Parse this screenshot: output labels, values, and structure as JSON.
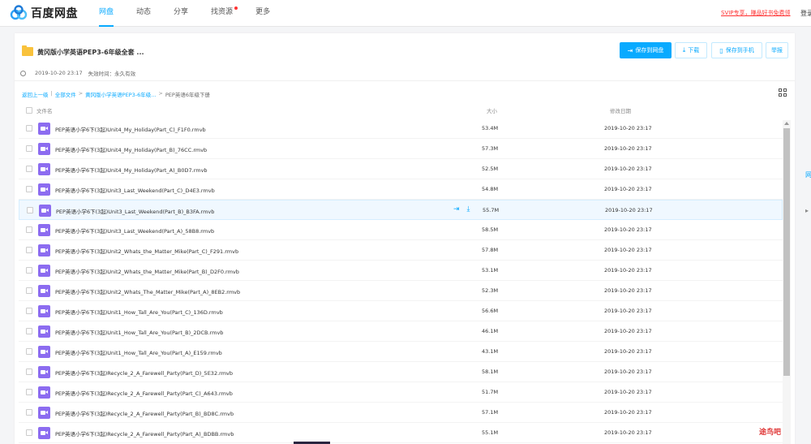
{
  "app": {
    "logo_text": "百度网盘",
    "nav": [
      {
        "label": "网盘",
        "active": true
      },
      {
        "label": "动态",
        "active": false
      },
      {
        "label": "分享",
        "active": false
      },
      {
        "label": "找资源",
        "active": false,
        "dot": true
      },
      {
        "label": "更多",
        "active": false
      }
    ],
    "promo": "SVIP专享，赚品好书免费领",
    "login": "登录"
  },
  "share": {
    "title": "黄冈版小学英语PEP3-6年级全套 ...",
    "created": "2019-10-20 23:17",
    "expiry": "失效时间：永久有效",
    "buttons": {
      "save": "保存到网盘",
      "download": "下载",
      "save_phone": "保存到手机",
      "report": "举报"
    }
  },
  "breadcrumb": {
    "back": "返回上一级",
    "all": "全部文件",
    "parent": "黄冈版小学英语PEP3-6年级...",
    "current": "PEP英语6年级下册"
  },
  "table": {
    "headers": {
      "name": "文件名",
      "size": "大小",
      "date": "修改日期"
    },
    "rows": [
      {
        "name": "PEP英语小学6下(3起)Unit4_My_Holiday(Part_C)_F1F0.rmvb",
        "size": "53.4M",
        "date": "2019-10-20 23:17"
      },
      {
        "name": "PEP英语小学6下(3起)Unit4_My_Holiday(Part_B)_76CC.rmvb",
        "size": "57.3M",
        "date": "2019-10-20 23:17"
      },
      {
        "name": "PEP英语小学6下(3起)Unit4_My_Holiday(Part_A)_B0D7.rmvb",
        "size": "52.5M",
        "date": "2019-10-20 23:17"
      },
      {
        "name": "PEP英语小学6下(3起)Unit3_Last_Weekend(Part_C)_D4E3.rmvb",
        "size": "54.8M",
        "date": "2019-10-20 23:17"
      },
      {
        "name": "PEP英语小学6下(3起)Unit3_Last_Weekend(Part_B)_B3FA.rmvb",
        "size": "55.7M",
        "date": "2019-10-20 23:17",
        "hover": true
      },
      {
        "name": "PEP英语小学6下(3起)Unit3_Last_Weekend(Part_A)_58B8.rmvb",
        "size": "58.5M",
        "date": "2019-10-20 23:17"
      },
      {
        "name": "PEP英语小学6下(3起)Unit2_Whats_the_Matter_Mike(Part_C)_F291.rmvb",
        "size": "57.8M",
        "date": "2019-10-20 23:17"
      },
      {
        "name": "PEP英语小学6下(3起)Unit2_Whats_the_Matter_Mike(Part_B)_D2F0.rmvb",
        "size": "53.1M",
        "date": "2019-10-20 23:17"
      },
      {
        "name": "PEP英语小学6下(3起)Unit2_Whats_The_Matter_Mike(Part_A)_8EB2.rmvb",
        "size": "52.3M",
        "date": "2019-10-20 23:17"
      },
      {
        "name": "PEP英语小学6下(3起)Unit1_How_Tall_Are_You(Part_C)_136D.rmvb",
        "size": "56.6M",
        "date": "2019-10-20 23:17"
      },
      {
        "name": "PEP英语小学6下(3起)Unit1_How_Tall_Are_You(Part_B)_2DCB.rmvb",
        "size": "46.1M",
        "date": "2019-10-20 23:17"
      },
      {
        "name": "PEP英语小学6下(3起)Unit1_How_Tall_Are_You(Part_A)_E159.rmvb",
        "size": "43.1M",
        "date": "2019-10-20 23:17"
      },
      {
        "name": "PEP英语小学6下(3起)Recycle_2_A_Farewell_Party(Part_D)_5E32.rmvb",
        "size": "58.1M",
        "date": "2019-10-20 23:17"
      },
      {
        "name": "PEP英语小学6下(3起)Recycle_2_A_Farewell_Party(Part_C)_A643.rmvb",
        "size": "51.7M",
        "date": "2019-10-20 23:17"
      },
      {
        "name": "PEP英语小学6下(3起)Recycle_2_A_Farewell_Party(Part_B)_BD8C.rmvb",
        "size": "57.1M",
        "date": "2019-10-20 23:17"
      },
      {
        "name": "PEP英语小学6下(3起)Recycle_2_A_Farewell_Party(Part_A)_BDBB.rmvb",
        "size": "55.1M",
        "date": "2019-10-20 23:17"
      }
    ]
  },
  "edge": {
    "label": "网"
  },
  "watermark": "途鸟吧",
  "colors": {
    "accent": "#09aaff",
    "video_icon": "#8c6cf0",
    "folder": "#f9c23c"
  }
}
